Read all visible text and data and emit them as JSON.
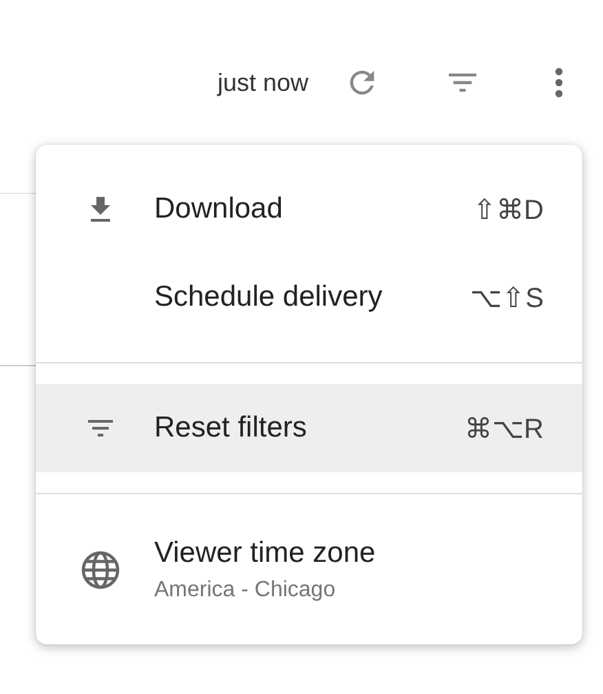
{
  "toolbar": {
    "updated": "just now"
  },
  "menu": {
    "sections": [
      {
        "items": [
          {
            "label": "Download",
            "shortcut": "⇧⌘D",
            "highlighted": false
          },
          {
            "label": "Schedule delivery",
            "shortcut": "⌥⇧S",
            "highlighted": false
          }
        ]
      },
      {
        "items": [
          {
            "label": "Reset filters",
            "shortcut": "⌘⌥R",
            "highlighted": true
          }
        ]
      },
      {
        "items": [
          {
            "label": "Viewer time zone",
            "sublabel": "America - Chicago",
            "highlighted": false
          }
        ]
      }
    ]
  }
}
